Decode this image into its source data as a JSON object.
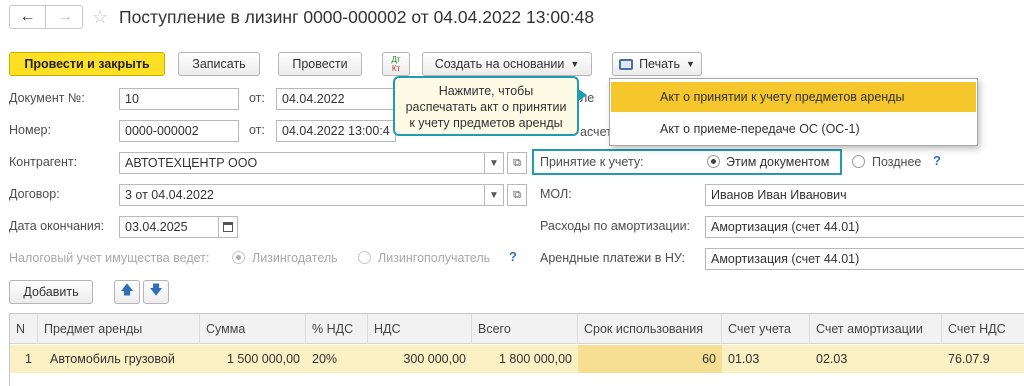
{
  "title": "Поступление в лизинг 0000-000002 от 04.04.2022 13:00:48",
  "toolbar": {
    "post_close": "Провести и закрыть",
    "save": "Записать",
    "post": "Провести",
    "dt_kt_top": "Дт",
    "dt_kt_bottom": "Кт",
    "create_based": "Создать на основании",
    "print": "Печать"
  },
  "tooltip": "Нажмите, чтобы распечатать акт о принятии к учету предметов аренды",
  "print_menu": {
    "items": [
      "Акт о принятии к учету предметов аренды",
      "Акт о приеме-передаче ОС (ОС-1)"
    ]
  },
  "form": {
    "doc_no_label": "Документ №:",
    "doc_no_value": "10",
    "from_label": "от:",
    "doc_date": "04.04.2022",
    "number_label": "Номер:",
    "number_value": "0000-000002",
    "number_date": "04.04.2022 13:00:4",
    "counterparty_label": "Контрагент:",
    "counterparty_value": "АВТОТЕХЦЕНТР ООО",
    "contract_label": "Договор:",
    "contract_value": "3 от 04.04.2022",
    "end_date_label": "Дата окончания:",
    "end_date_value": "03.04.2025",
    "tax_label": "Налоговый учет имущества ведет:",
    "tax_lessor": "Лизингодатель",
    "tax_lessee": "Лизингополучатель",
    "partial_1": "ле",
    "partial_2": "асчет",
    "accept_label": "Принятие к учету:",
    "accept_this": "Этим документом",
    "accept_later": "Позднее",
    "mol_label": "МОЛ:",
    "mol_value": "Иванов Иван Иванович",
    "amort_label": "Расходы по амортизации:",
    "amort_value": "Амортизация (счет 44.01)",
    "lease_label": "Арендные платежи в НУ:",
    "lease_value": "Амортизация (счет 44.01)",
    "help": "?"
  },
  "table_toolbar": {
    "add": "Добавить"
  },
  "table": {
    "headers": [
      "N",
      "Предмет аренды",
      "Сумма",
      "% НДС",
      "НДС",
      "Всего",
      "Срок использования",
      "Счет учета",
      "Счет амортизации",
      "Счет НДС"
    ],
    "rows": [
      [
        "1",
        "Автомобиль грузовой",
        "1 500 000,00",
        "20%",
        "300 000,00",
        "1 800 000,00",
        "60",
        "01.03",
        "02.03",
        "76.07.9"
      ]
    ]
  },
  "colors": {
    "accent_yellow": "#fde023",
    "highlight_teal": "#1f9bb4",
    "row_yellow": "#fbf0c3",
    "help_blue": "#2f72c2"
  }
}
